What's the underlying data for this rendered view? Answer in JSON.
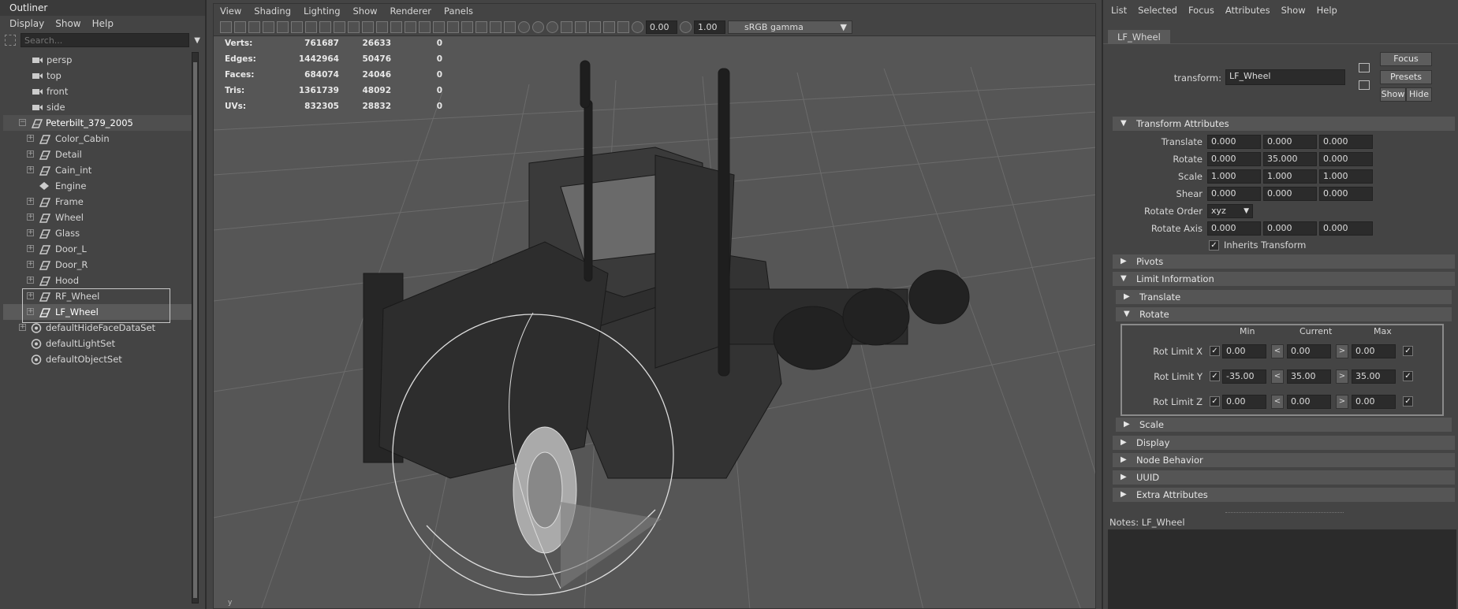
{
  "outliner": {
    "title": "Outliner",
    "menu": [
      "Display",
      "Show",
      "Help"
    ],
    "search_placeholder": "Search...",
    "items": [
      {
        "label": "persp",
        "icon": "camera-icon"
      },
      {
        "label": "top",
        "icon": "camera-icon"
      },
      {
        "label": "front",
        "icon": "camera-icon"
      },
      {
        "label": "side",
        "icon": "camera-icon"
      },
      {
        "label": "Peterbilt_379_2005",
        "icon": "transform-icon"
      },
      {
        "label": "Color_Cabin",
        "icon": "transform-icon"
      },
      {
        "label": "Detail",
        "icon": "transform-icon"
      },
      {
        "label": "Cain_int",
        "icon": "transform-icon"
      },
      {
        "label": "Engine",
        "icon": "joint-icon"
      },
      {
        "label": "Frame",
        "icon": "transform-icon"
      },
      {
        "label": "Wheel",
        "icon": "transform-icon"
      },
      {
        "label": "Glass",
        "icon": "transform-icon"
      },
      {
        "label": "Door_L",
        "icon": "transform-icon"
      },
      {
        "label": "Door_R",
        "icon": "transform-icon"
      },
      {
        "label": "Hood",
        "icon": "transform-icon"
      },
      {
        "label": "RF_Wheel",
        "icon": "transform-icon"
      },
      {
        "label": "LF_Wheel",
        "icon": "transform-icon"
      },
      {
        "label": "defaultHideFaceDataSet",
        "icon": "set-icon"
      },
      {
        "label": "defaultLightSet",
        "icon": "set-icon"
      },
      {
        "label": "defaultObjectSet",
        "icon": "set-icon"
      }
    ]
  },
  "viewport": {
    "menu": [
      "View",
      "Shading",
      "Lighting",
      "Show",
      "Renderer",
      "Panels"
    ],
    "exposure": "0.00",
    "gamma": "1.00",
    "color_space": "sRGB gamma",
    "hud": [
      {
        "label": "Verts:",
        "a": "761687",
        "b": "26633",
        "c": "0"
      },
      {
        "label": "Edges:",
        "a": "1442964",
        "b": "50476",
        "c": "0"
      },
      {
        "label": "Faces:",
        "a": "684074",
        "b": "24046",
        "c": "0"
      },
      {
        "label": "Tris:",
        "a": "1361739",
        "b": "48092",
        "c": "0"
      },
      {
        "label": "UVs:",
        "a": "832305",
        "b": "28832",
        "c": "0"
      }
    ]
  },
  "attr": {
    "menu": [
      "List",
      "Selected",
      "Focus",
      "Attributes",
      "Show",
      "Help"
    ],
    "tab": "LF_Wheel",
    "transform_label": "transform:",
    "transform_value": "LF_Wheel",
    "btn_focus": "Focus",
    "btn_presets": "Presets",
    "btn_show": "Show",
    "btn_hide": "Hide",
    "section_transform": "Transform Attributes",
    "translate_label": "Translate",
    "translate": [
      "0.000",
      "0.000",
      "0.000"
    ],
    "rotate_label": "Rotate",
    "rotate": [
      "0.000",
      "35.000",
      "0.000"
    ],
    "scale_label": "Scale",
    "scale": [
      "1.000",
      "1.000",
      "1.000"
    ],
    "shear_label": "Shear",
    "shear": [
      "0.000",
      "0.000",
      "0.000"
    ],
    "rotate_order_label": "Rotate Order",
    "rotate_order": "xyz",
    "rotate_axis_label": "Rotate Axis",
    "rotate_axis": [
      "0.000",
      "0.000",
      "0.000"
    ],
    "inherits_label": "Inherits Transform",
    "section_pivots": "Pivots",
    "section_limit": "Limit Information",
    "sub_translate": "Translate",
    "sub_rotate": "Rotate",
    "col_min": "Min",
    "col_current": "Current",
    "col_max": "Max",
    "limits": [
      {
        "label": "Rot Limit X",
        "min": "0.00",
        "current": "0.00",
        "max": "0.00"
      },
      {
        "label": "Rot Limit Y",
        "min": "-35.00",
        "current": "35.00",
        "max": "35.00"
      },
      {
        "label": "Rot Limit Z",
        "min": "0.00",
        "current": "0.00",
        "max": "0.00"
      }
    ],
    "lt": "<",
    "gt": ">",
    "sub_scale": "Scale",
    "section_display": "Display",
    "section_node_behavior": "Node Behavior",
    "section_uuid": "UUID",
    "section_extra": "Extra Attributes",
    "notes_label": "Notes:  LF_Wheel"
  }
}
